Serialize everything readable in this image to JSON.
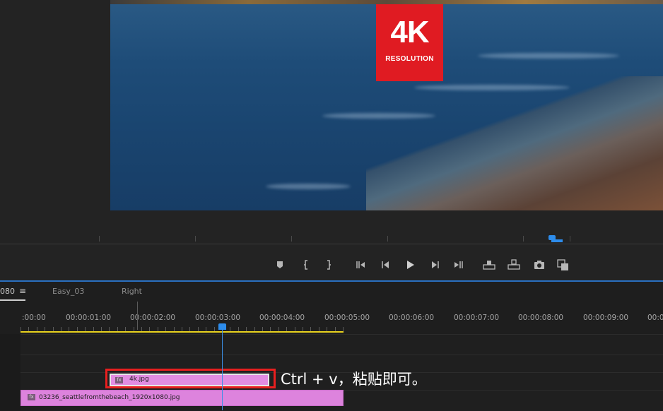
{
  "monitor": {
    "badge_big": "4K",
    "badge_small": "RESOLUTION"
  },
  "transport": {
    "buttons": [
      "marker-icon",
      "mark-in-icon",
      "mark-out-icon",
      "go-to-in-icon",
      "step-back-icon",
      "play-icon",
      "step-forward-icon",
      "go-to-out-icon",
      "lift-icon",
      "extract-icon",
      "export-frame-icon",
      "compare-icon"
    ]
  },
  "timeline": {
    "tabs": [
      {
        "label": "080"
      },
      {
        "label": "Easy_03"
      },
      {
        "label": "Right"
      }
    ],
    "tab_menu_glyph": "≡",
    "timecodes": [
      ":00:00",
      "00:00:01:00",
      "00:00:02:00",
      "00:00:03:00",
      "00:00:04:00",
      "00:00:05:00",
      "00:00:06:00",
      "00:00:07:00",
      "00:00:08:00",
      "00:00:09:00",
      "00:0"
    ],
    "clips": [
      {
        "label": "4k.jpg"
      },
      {
        "label": "03236_seattlefromthebeach_1920x1080.jpg"
      }
    ],
    "fx_label": "fx"
  },
  "annotation": "Ctrl + v，粘贴即可。",
  "colors": {
    "accent_blue": "#2d8ceb",
    "work_area": "#e8d21e",
    "clip": "#dd83dd",
    "highlight": "#e81f1f",
    "badge": "#e01b22"
  }
}
